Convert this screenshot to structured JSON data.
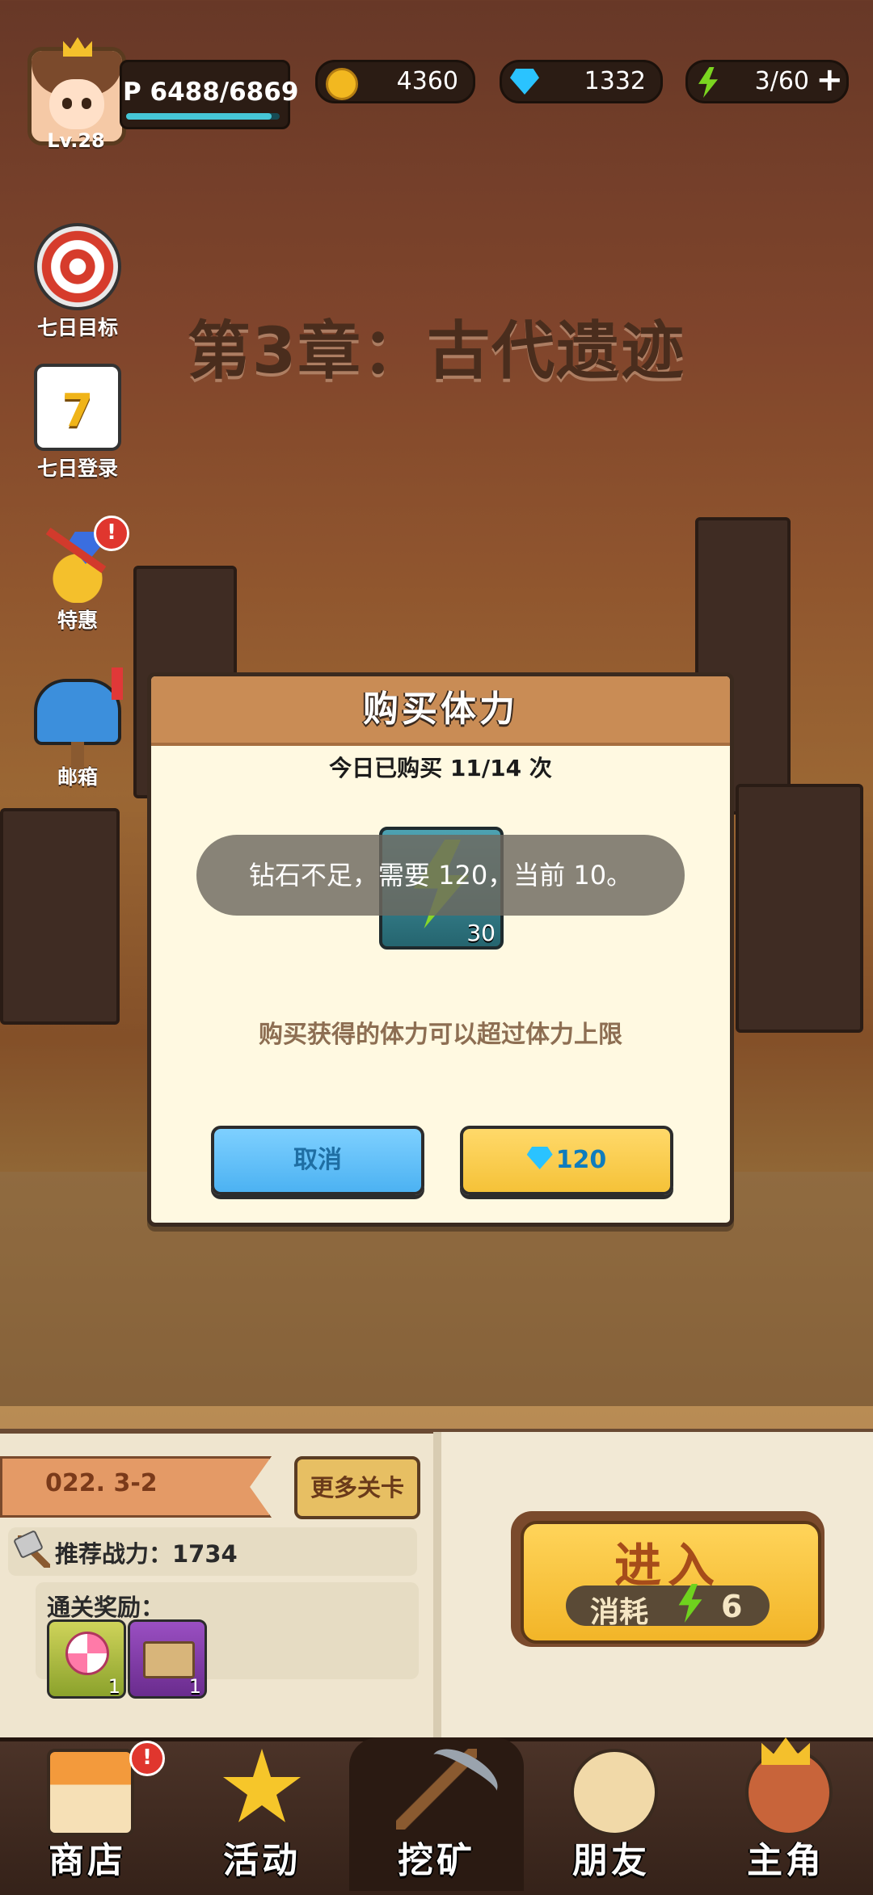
{
  "player": {
    "level": "Lv.28",
    "exp_text": "P 6488/6869",
    "exp_ratio": 0.945
  },
  "resources": {
    "gold": "4360",
    "gems": "1332",
    "energy": "3/60",
    "energy_plus": "+"
  },
  "side_menu": [
    {
      "label": "七日目标",
      "icon": "target-icon"
    },
    {
      "label": "七日登录",
      "icon": "calendar-icon",
      "day": "7"
    },
    {
      "label": "特惠",
      "icon": "deal-icon",
      "badge": "!"
    },
    {
      "label": "邮箱",
      "icon": "mailbox-icon"
    }
  ],
  "chapter_title": "第3章：古代遗迹",
  "dialog": {
    "title": "购买体力",
    "count_text": "今日已购买 11/14 次",
    "energy_amount": "30",
    "toast": "钻石不足，需要 120，当前 10。",
    "hint": "购买获得的体力可以超过体力上限",
    "cancel_label": "取消",
    "buy_price": "120"
  },
  "stage": {
    "id": "022. 3-2",
    "more_label": "更多关卡",
    "power_text": "推荐战力：1734",
    "reward_label": "通关奖励：",
    "rewards": [
      {
        "name": "lollipop",
        "count": "1"
      },
      {
        "name": "ticket",
        "count": "1"
      }
    ],
    "enter_label": "进入",
    "cost_label": "消耗",
    "cost_value": "6"
  },
  "nav": [
    {
      "label": "商店",
      "badge": "!"
    },
    {
      "label": "活动"
    },
    {
      "label": "挖矿",
      "active": true
    },
    {
      "label": "朋友"
    },
    {
      "label": "主角"
    }
  ],
  "colors": {
    "accent_gold": "#f2b528",
    "gem_blue": "#2ac3ff",
    "energy_green": "#7bd520",
    "dialog_header": "#c98c55"
  }
}
